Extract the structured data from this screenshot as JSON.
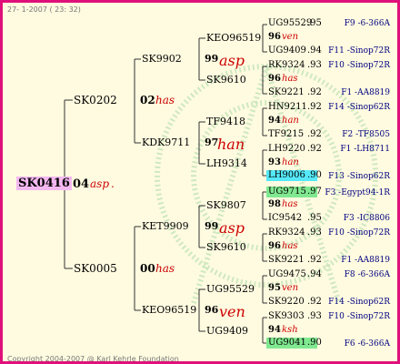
{
  "header_date": "27- 1-2007 ( 23: 32)",
  "footer": "Copyright 2004-2007 @ Karl Kehrle Foundation",
  "root": {
    "id": "SK0416",
    "year": "04",
    "race": "asp",
    "dot": "."
  },
  "gen1": [
    {
      "id": "SK0202",
      "year": "02",
      "race": "has"
    },
    {
      "id": "SK0005",
      "year": "00",
      "race": "has"
    }
  ],
  "gen2": [
    {
      "id": "SK9902",
      "year": "99",
      "race": "asp"
    },
    {
      "id": "KDK9711",
      "year": "97",
      "race": "han"
    },
    {
      "id": "KET9909",
      "year": "99",
      "race": "asp"
    },
    {
      "id": "KEO96519",
      "year": "96",
      "race": "ven"
    }
  ],
  "gen3": [
    {
      "id": "KEO96519",
      "year": "96",
      "race": "ven"
    },
    {
      "id": "SK9610",
      "year": "96",
      "race": "has"
    },
    {
      "id": "TF9418",
      "year": "94",
      "race": "han"
    },
    {
      "id": "LH9314",
      "year": "93",
      "race": "han"
    },
    {
      "id": "SK9807",
      "year": "98",
      "race": "has"
    },
    {
      "id": "SK9610",
      "year": "96",
      "race": "has"
    },
    {
      "id": "UG95529",
      "year": "95",
      "race": "ven"
    },
    {
      "id": "UG9409",
      "year": "94",
      "race": "ksh"
    }
  ],
  "gen4": [
    {
      "id": "UG95529",
      "num": ".95",
      "code": "F9 -6-366A"
    },
    {
      "id": "UG9409",
      "num": ".94",
      "code": "F11 -Sinop72R"
    },
    {
      "id": "RK9324",
      "num": ".93",
      "code": "F10 -Sinop72R"
    },
    {
      "id": "SK9221",
      "num": ".92",
      "code": "F1 -AA8819"
    },
    {
      "id": "HN9211",
      "num": ".92",
      "code": "F14 -Sinop62R"
    },
    {
      "id": "TF9215",
      "num": ".92",
      "code": "F2 -TF8505"
    },
    {
      "id": "LH9220",
      "num": ".92",
      "code": "F1 -LH8711"
    },
    {
      "id": "LH9006",
      "num": ".90",
      "code": "F13 -Sinop62R"
    },
    {
      "id": "UG9715",
      "num": ".97",
      "code": "F3 -Egypt94-1R"
    },
    {
      "id": "IC9542",
      "num": ".95",
      "code": "F3 -IC8806"
    },
    {
      "id": "RK9324",
      "num": ".93",
      "code": "F10 -Sinop72R"
    },
    {
      "id": "SK9221",
      "num": ".92",
      "code": "F1 -AA8819"
    },
    {
      "id": "UG9475",
      "num": ".94",
      "code": "F8 -6-366A"
    },
    {
      "id": "SK9220",
      "num": ".92",
      "code": "F14 -Sinop62R"
    },
    {
      "id": "SK9303",
      "num": ".93",
      "code": "F10 -Sinop72R"
    },
    {
      "id": "UG9041",
      "num": ".90",
      "code": "F6 -6-366A"
    }
  ],
  "colors": {
    "frame": "#e0107a",
    "background": "#fffbe0",
    "race": "#cc0000",
    "code": "#000080",
    "root_highlight": "#f4b8f0",
    "cyan_highlight": "#55e8f8",
    "green_highlight": "#80e890"
  }
}
